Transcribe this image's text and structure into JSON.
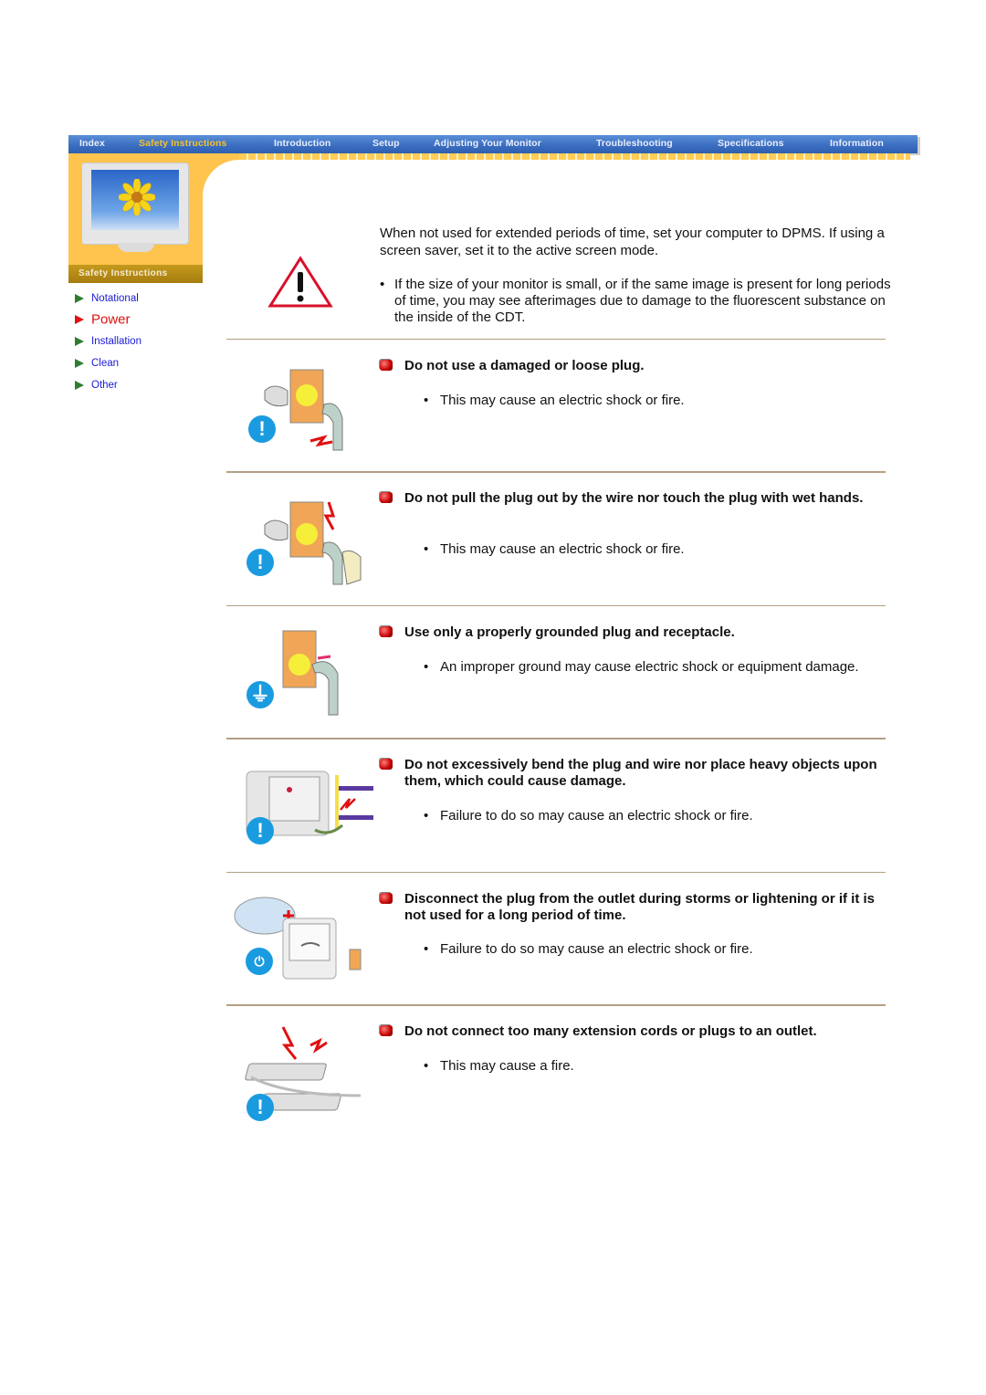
{
  "nav": {
    "items": [
      {
        "label": "Index",
        "active": false
      },
      {
        "label": "Safety Instructions",
        "active": true
      },
      {
        "label": "Introduction",
        "active": false
      },
      {
        "label": "Setup",
        "active": false
      },
      {
        "label": "Adjusting Your Monitor",
        "active": false
      },
      {
        "label": "Troubleshooting",
        "active": false
      },
      {
        "label": "Specifications",
        "active": false
      },
      {
        "label": "Information",
        "active": false
      }
    ]
  },
  "sidebar": {
    "banner": "Safety Instructions",
    "items": [
      {
        "label": "Notational",
        "active": false
      },
      {
        "label": "Power",
        "active": true
      },
      {
        "label": "Installation",
        "active": false
      },
      {
        "label": "Clean",
        "active": false
      },
      {
        "label": "Other",
        "active": false
      }
    ]
  },
  "intro": {
    "icon": "warning-triangle-icon",
    "paragraph": "When not used for extended periods of time, set your computer to DPMS. If using a screen saver, set it to the active screen mode.",
    "bullet": "If the size of your monitor is small, or if the same image is present for long periods of time, you may see afterimages due to damage to the fluorescent substance on the inside of the CDT."
  },
  "sections": [
    {
      "title": "Do not use a damaged or loose plug.",
      "bullet": "This may cause an electric shock or fire.",
      "icon": "exclamation-icon",
      "illustration": "damaged-plug-illustration"
    },
    {
      "title": "Do not pull the plug out by the wire nor touch the plug with wet hands.",
      "bullet": "This may cause an electric shock or fire.",
      "icon": "exclamation-icon",
      "illustration": "wet-hands-plug-illustration"
    },
    {
      "title": "Use only a properly grounded plug and receptacle.",
      "bullet": "An improper ground may cause electric shock or equipment damage.",
      "icon": "ground-icon",
      "illustration": "grounded-plug-illustration"
    },
    {
      "title": "Do not excessively bend the plug and wire nor place heavy objects upon them, which could cause damage.",
      "bullet": "Failure to do so may cause an electric shock or fire.",
      "icon": "exclamation-icon",
      "illustration": "bent-wire-illustration"
    },
    {
      "title": "Disconnect the plug from the outlet during storms or lightening or if it is not used for a long period of time.",
      "bullet": "Failure to do so may cause an electric shock or fire.",
      "icon": "unplug-icon",
      "illustration": "storm-unplug-illustration"
    },
    {
      "title": "Do not connect too many extension cords or plugs to an outlet.",
      "bullet": "This may cause a fire.",
      "icon": "exclamation-icon",
      "illustration": "overloaded-outlet-illustration"
    }
  ]
}
